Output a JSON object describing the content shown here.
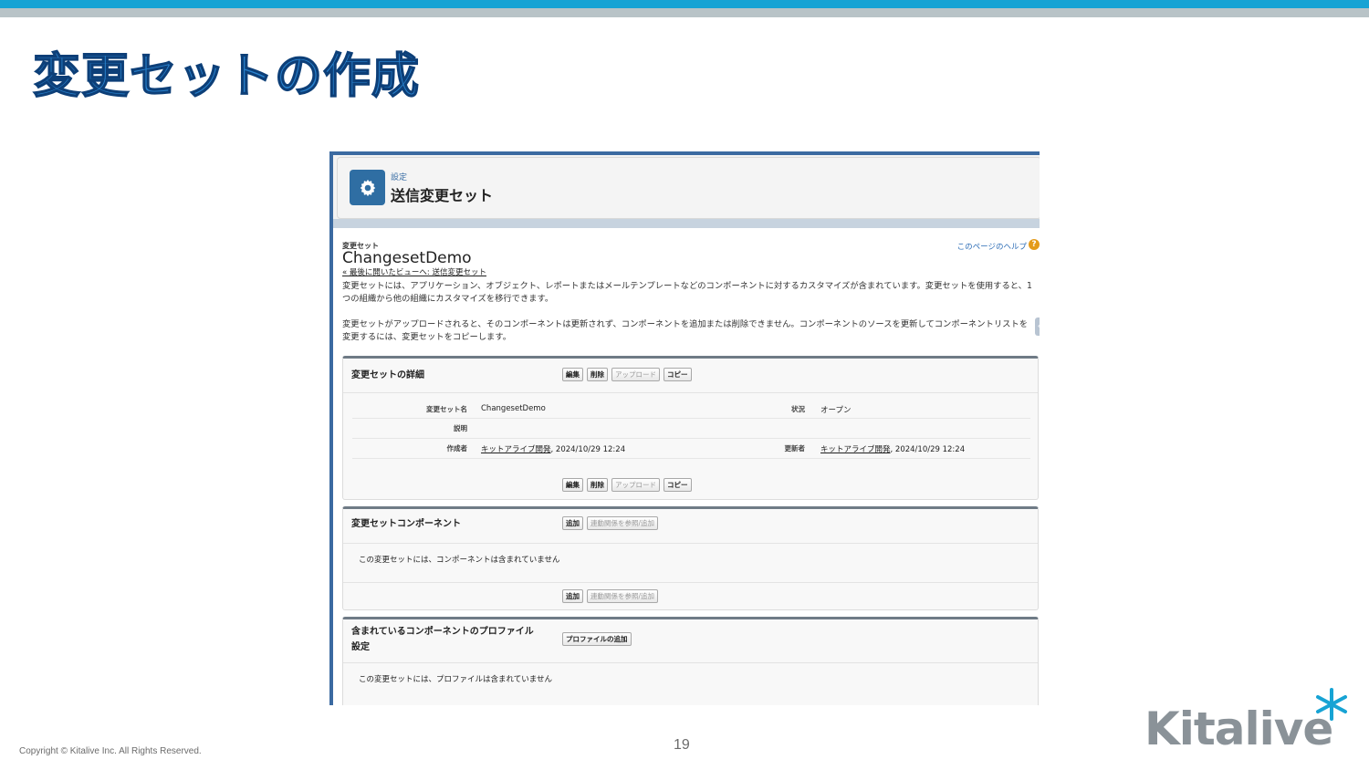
{
  "slide": {
    "title": "変更セットの作成",
    "copyright": "Copyright © Kitalive Inc. All Rights Reserved.",
    "page_number": "19",
    "logo_text": "Kitalive"
  },
  "header": {
    "breadcrumb": "設定",
    "title": "送信変更セット"
  },
  "record": {
    "type_label": "変更セット",
    "name": "ChangesetDemo",
    "back_link": "« 最後に開いたビューへ: 送信変更セット",
    "help_link": "このページのヘルプ",
    "help_icon": "?",
    "description_1": "変更セットには、アプリケーション、オブジェクト、レポートまたはメールテンプレートなどのコンポーネントに対するカスタマイズが含まれています。変更セットを使用すると、1 つの組織から他の組織にカスタマイズを移行できます。",
    "description_2": "変更セットがアップロードされると、そのコンポーネントは更新されず、コンポーネントを追加または削除できません。コンポーネントのソースを更新してコンポーネントリストを変更するには、変更セットをコピーします。"
  },
  "details_panel": {
    "title": "変更セットの詳細",
    "buttons": {
      "edit": "編集",
      "delete": "削除",
      "upload": "アップロード",
      "copy": "コピー"
    },
    "fields": {
      "name_label": "変更セット名",
      "name_value": "ChangesetDemo",
      "status_label": "状況",
      "status_value": "オープン",
      "description_label": "説明",
      "created_by_label": "作成者",
      "created_by_user": "キットアライブ開発",
      "created_by_date": ", 2024/10/29 12:24",
      "modified_by_label": "更新者",
      "modified_by_user": "キットアライブ開発",
      "modified_by_date": ", 2024/10/29 12:24"
    }
  },
  "components_panel": {
    "title": "変更セットコンポーネント",
    "add_button": "追加",
    "deps_button": "連動関係を参照/追加",
    "empty_message": "この変更セットには、コンポーネントは含まれていません"
  },
  "profiles_panel": {
    "title_line1": "含まれているコンポーネントのプロファイル",
    "title_line2": "設定",
    "add_profile_button": "プロファイルの追加",
    "empty_message": "この変更セットには、プロファイルは含まれていません"
  },
  "colors": {
    "accent_bar": "#17a3d4",
    "title_blue": "#2a84d0",
    "setup_icon": "#2f6ea3",
    "link_blue": "#2a6bb5",
    "help_orange": "#e49b1a"
  },
  "icons": [
    "gear-icon",
    "help-icon",
    "collapse-arrow-icon"
  ]
}
